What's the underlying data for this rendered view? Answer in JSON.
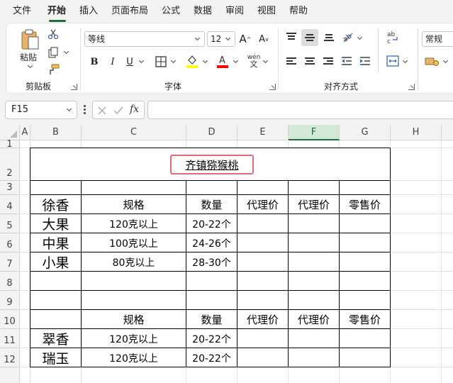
{
  "menu": {
    "items": [
      "文件",
      "开始",
      "插入",
      "页面布局",
      "公式",
      "数据",
      "审阅",
      "视图",
      "帮助"
    ],
    "active": "开始"
  },
  "ribbon": {
    "clipboard": {
      "paste_label": "粘贴",
      "group_label": "剪贴板"
    },
    "font": {
      "font_name": "等线",
      "font_size": "12",
      "group_label": "字体",
      "phonetic_label": "wén\n文"
    },
    "alignment": {
      "group_label": "对齐方式"
    },
    "number": {
      "format": "常规"
    },
    "colors": {
      "highlight": "#ffff00",
      "font_color": "#ff0000"
    }
  },
  "formula_bar": {
    "name_box": "F15",
    "fx_label": "fx",
    "formula": ""
  },
  "sheet": {
    "columns": [
      "A",
      "B",
      "C",
      "D",
      "E",
      "F",
      "G",
      "H"
    ],
    "selected_column": "F",
    "rows": [
      "1",
      "2",
      "3",
      "4",
      "5",
      "6",
      "7",
      "8",
      "9",
      "10",
      "11",
      "12"
    ],
    "title": "齐镇猕猴桃",
    "table1": {
      "header": [
        "徐香",
        "规格",
        "数量",
        "代理价",
        "代理价",
        "零售价"
      ],
      "rows": [
        [
          "大果",
          "120克以上",
          "20-22个"
        ],
        [
          "中果",
          "100克以上",
          "24-26个"
        ],
        [
          "小果",
          "80克以上",
          "28-30个"
        ]
      ]
    },
    "table2": {
      "header": [
        "",
        "规格",
        "数量",
        "代理价",
        "代理价",
        "零售价"
      ],
      "rows": [
        [
          "翠香",
          "120克以上",
          "20-22个"
        ],
        [
          "瑞玉",
          "120克以上",
          "20-22个"
        ]
      ]
    }
  }
}
